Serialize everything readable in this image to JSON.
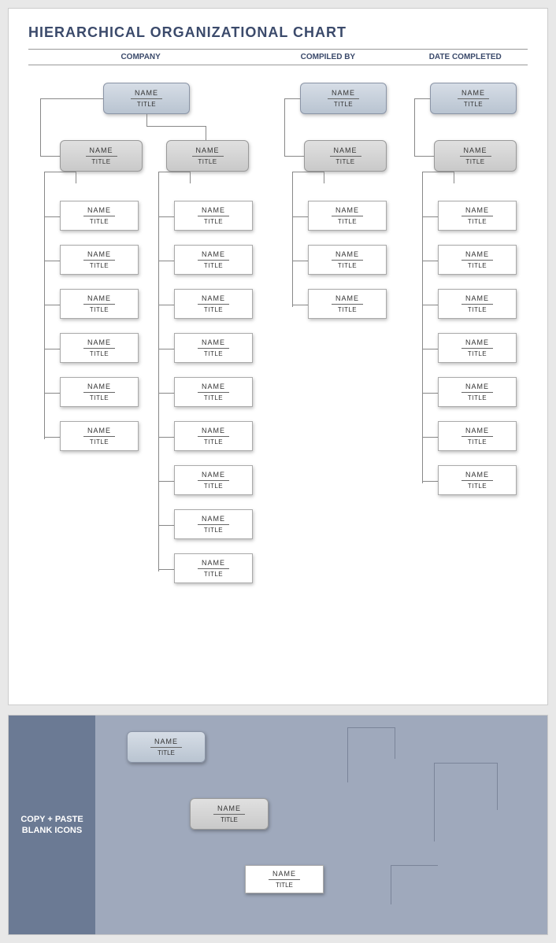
{
  "chart_title": "HIERARCHICAL ORGANIZATIONAL CHART",
  "header": {
    "col1": "COMPANY",
    "col2": "COMPILED BY",
    "col3": "DATE COMPLETED"
  },
  "node_labels": {
    "name": "NAME",
    "title": "TITLE"
  },
  "structure": {
    "group1": {
      "top": {
        "name": "NAME",
        "title": "TITLE"
      },
      "branches": [
        {
          "head": {
            "name": "NAME",
            "title": "TITLE"
          },
          "leaves": [
            {
              "name": "NAME",
              "title": "TITLE"
            },
            {
              "name": "NAME",
              "title": "TITLE"
            },
            {
              "name": "NAME",
              "title": "TITLE"
            },
            {
              "name": "NAME",
              "title": "TITLE"
            },
            {
              "name": "NAME",
              "title": "TITLE"
            },
            {
              "name": "NAME",
              "title": "TITLE"
            }
          ]
        },
        {
          "head": {
            "name": "NAME",
            "title": "TITLE"
          },
          "leaves": [
            {
              "name": "NAME",
              "title": "TITLE"
            },
            {
              "name": "NAME",
              "title": "TITLE"
            },
            {
              "name": "NAME",
              "title": "TITLE"
            },
            {
              "name": "NAME",
              "title": "TITLE"
            },
            {
              "name": "NAME",
              "title": "TITLE"
            },
            {
              "name": "NAME",
              "title": "TITLE"
            },
            {
              "name": "NAME",
              "title": "TITLE"
            },
            {
              "name": "NAME",
              "title": "TITLE"
            },
            {
              "name": "NAME",
              "title": "TITLE"
            }
          ]
        }
      ]
    },
    "group2": {
      "top": {
        "name": "NAME",
        "title": "TITLE"
      },
      "head": {
        "name": "NAME",
        "title": "TITLE"
      },
      "leaves": [
        {
          "name": "NAME",
          "title": "TITLE"
        },
        {
          "name": "NAME",
          "title": "TITLE"
        },
        {
          "name": "NAME",
          "title": "TITLE"
        }
      ]
    },
    "group3": {
      "top": {
        "name": "NAME",
        "title": "TITLE"
      },
      "head": {
        "name": "NAME",
        "title": "TITLE"
      },
      "leaves": [
        {
          "name": "NAME",
          "title": "TITLE"
        },
        {
          "name": "NAME",
          "title": "TITLE"
        },
        {
          "name": "NAME",
          "title": "TITLE"
        },
        {
          "name": "NAME",
          "title": "TITLE"
        },
        {
          "name": "NAME",
          "title": "TITLE"
        },
        {
          "name": "NAME",
          "title": "TITLE"
        },
        {
          "name": "NAME",
          "title": "TITLE"
        }
      ]
    }
  },
  "palette": {
    "label": "COPY + PASTE\nBLANK ICONS",
    "samples": [
      {
        "kind": "blue",
        "name": "NAME",
        "title": "TITLE"
      },
      {
        "kind": "gray",
        "name": "NAME",
        "title": "TITLE"
      },
      {
        "kind": "white",
        "name": "NAME",
        "title": "TITLE"
      }
    ]
  }
}
